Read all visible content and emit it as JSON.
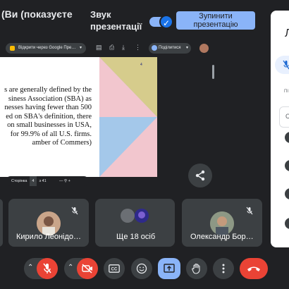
{
  "presenter": {
    "title": "(Ви (показуєте",
    "sound_label_line1": "Звук",
    "sound_label_line2": "презентації",
    "stop_label_line1": "Зупинити",
    "stop_label_line2": "презентацію"
  },
  "shared_browser": {
    "tab_text": "Відкрити через Google Пре…",
    "people_label": "Поділитися",
    "slide_text": "s are generally defined by the\nsiness Association (SBA) as\nnesses having fewer than 500\ned on SBA's definition, there\non small businesses in USA,\nfor 99.9% of all U.S. firms.\namber of Commers)",
    "slide_number": "4",
    "pdf_page_label": "Сторінка",
    "pdf_page": "4",
    "pdf_of": "з",
    "pdf_total": "41",
    "pdf_zoom_out": "—",
    "pdf_zoom_in": "+"
  },
  "tiles": [
    {
      "name": "Кирило Леонідо…",
      "muted": true
    },
    {
      "name": "Ще 18 осіб",
      "muted": false
    },
    {
      "name": "Олександр Бор…",
      "muted": true
    }
  ],
  "panel": {
    "title_initial": "Л",
    "small_label": "ПІ",
    "box_label": "С"
  },
  "colors": {
    "background": "#202124",
    "accent": "#8ab4f8",
    "danger": "#ea4335",
    "tile": "#3c4043"
  }
}
